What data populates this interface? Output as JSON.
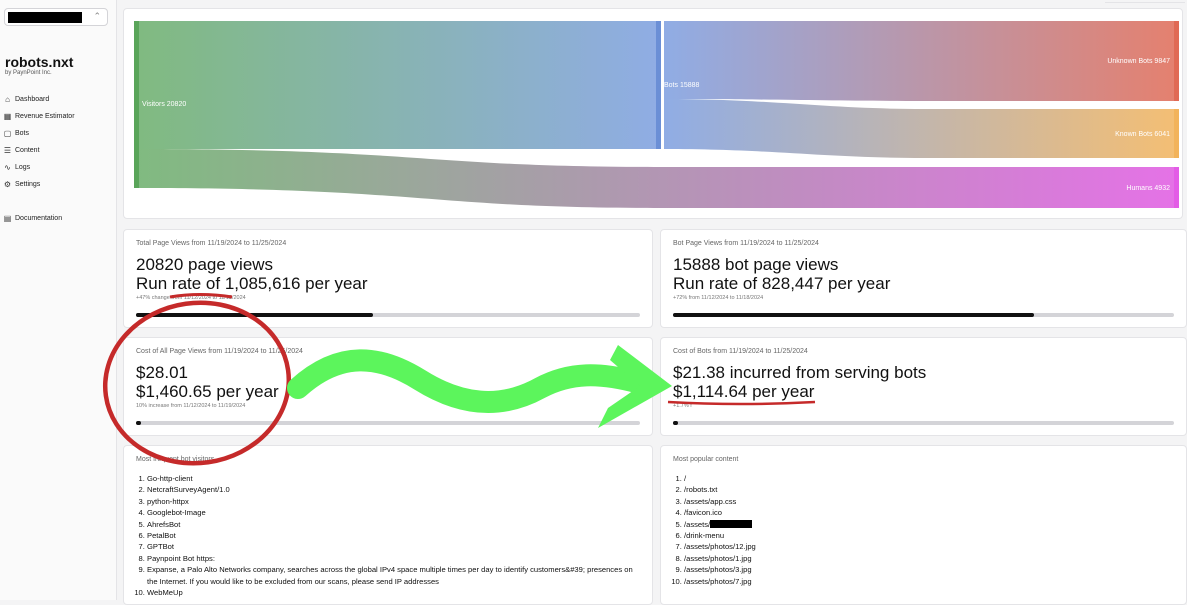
{
  "sidebar": {
    "brand": "robots.nxt",
    "brand_sub": "by PaynPoint Inc.",
    "items": [
      {
        "label": "Dashboard",
        "icon": "home-icon"
      },
      {
        "label": "Revenue Estimator",
        "icon": "calculator-icon"
      },
      {
        "label": "Bots",
        "icon": "bot-icon"
      },
      {
        "label": "Content",
        "icon": "list-icon"
      },
      {
        "label": "Logs",
        "icon": "activity-icon"
      },
      {
        "label": "Settings",
        "icon": "gear-icon"
      }
    ],
    "documentation": "Documentation"
  },
  "sankey": {
    "visitors": "Visitors 20820",
    "bots": "Bots 15888",
    "unknown": "Unknown Bots 9847",
    "known": "Known Bots 6041",
    "humans": "Humans 4932",
    "colors": {
      "visitors": "#5aa55a",
      "bots": "#6b8fd6",
      "unknown": "#e06a55",
      "known": "#f2b35b",
      "humans": "#e35ce6"
    }
  },
  "cards": {
    "total": {
      "subtitle": "Total Page Views from 11/19/2024 to 11/25/2024",
      "line1": "20820 page views",
      "line2": "Run rate of 1,085,616 per year",
      "change": "+47% change from 11/12/2024 to 11/18/2024",
      "progress": 0.47
    },
    "bot": {
      "subtitle": "Bot Page Views from 11/19/2024 to 11/25/2024",
      "line1": "15888 bot page views",
      "line2": "Run rate of 828,447 per year",
      "change": "+72% from 11/12/2024 to 11/18/2024",
      "progress": 0.72
    },
    "cost_all": {
      "subtitle": "Cost of All Page Views from 11/19/2024 to 11/25/2024",
      "line1": "$28.01",
      "line2": "$1,460.65 per year",
      "change": "10% increase from 11/12/2024 to 11/19/2024",
      "progress": 0.01
    },
    "cost_bots": {
      "subtitle": "Cost of Bots from 11/19/2024 to 11/25/2024",
      "line1": "$21.38 incurred from serving bots",
      "line2": "$1,114.64 per year",
      "change": "+1.7% f",
      "progress": 0.01
    }
  },
  "bot_visitors": {
    "title": "Most frequent bot visitors",
    "items": [
      "Go-http-client",
      "NetcraftSurveyAgent/1.0",
      "python-httpx",
      "Googlebot-Image",
      "AhrefsBot",
      "PetalBot",
      "GPTBot",
      "Paynpoint Bot https:",
      "Expanse, a Palo Alto Networks company, searches across the global IPv4 space multiple times per day to identify customers&#39; presences on the Internet. If you would like to be excluded from our scans, please send IP addresses",
      "WebMeUp"
    ]
  },
  "popular_content": {
    "title": "Most popular content",
    "items": [
      "/",
      "/robots.txt",
      "/assets/app.css",
      "/favicon.ico",
      "/assets/",
      "/drink-menu",
      "/assets/photos/12.jpg",
      "/assets/photos/1.jpg",
      "/assets/photos/3.jpg",
      "/assets/photos/7.jpg"
    ]
  },
  "annotation_colors": {
    "circle": "#c52a2a",
    "arrow": "#5cf55c",
    "underline": "#c52a2a"
  }
}
